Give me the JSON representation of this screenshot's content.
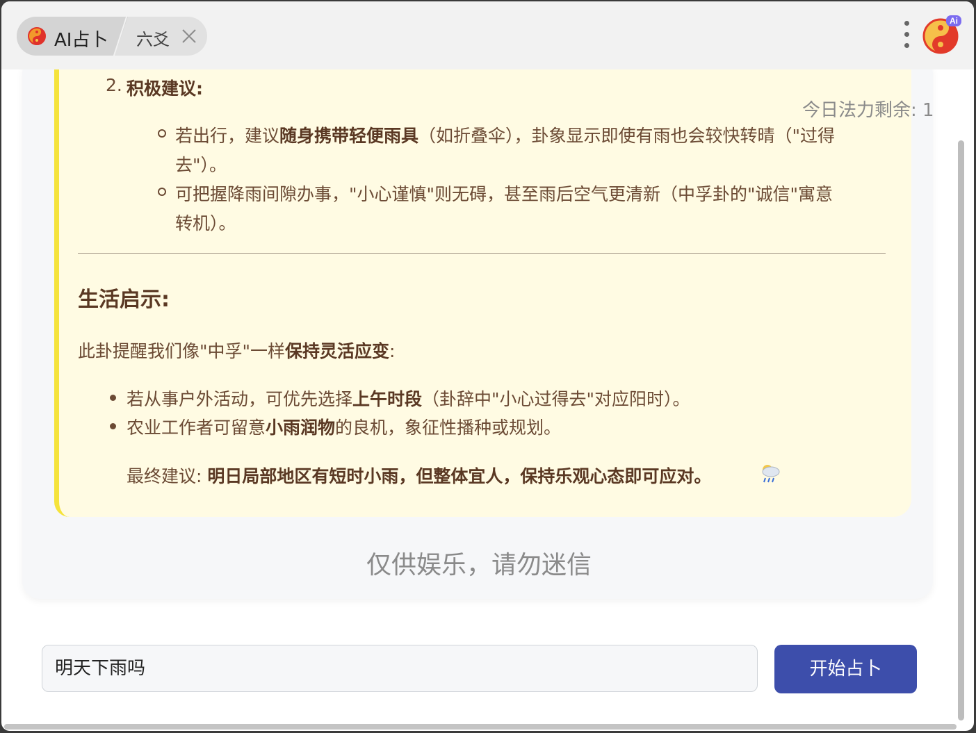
{
  "tabs": {
    "active_label": "AI占卜",
    "second_label": "六爻"
  },
  "quota": "今日法力剩余: 1",
  "badge": "Ai",
  "reading": {
    "section2_number": "2.",
    "section2_title": "积极建议:",
    "bullet1_line1_pre": "若出行，建议",
    "bullet1_line1_bold": "随身携带轻便雨具",
    "bullet1_line1_post": "（如折叠伞），卦象显示即使有雨也会较快转晴（\"过得",
    "bullet1_line2": "去\"）。",
    "bullet2_line1": "可把握降雨间隙办事，\"小心谨慎\"则无碍，甚至雨后空气更清新（中孚卦的\"诚信\"寓意",
    "bullet2_line2": "转机）。",
    "life_title": "生活启示:",
    "life_intro_pre": "此卦提醒我们像\"中孚\"一样",
    "life_intro_bold": "保持灵活应变",
    "life_intro_post": ":",
    "life_item1_pre": "若从事户外活动，可优先选择",
    "life_item1_bold": "上午时段",
    "life_item1_post": "（卦辞中\"小心过得去\"对应阳时）。",
    "life_item2_pre": "农业工作者可留意",
    "life_item2_bold": "小雨润物",
    "life_item2_post": "的良机，象征性播种或规划。",
    "final_label": "最终建议:",
    "final_bold": "明日局部地区有短时小雨，但整体宜人，保持乐观心态即可应对。",
    "final_emoji": "🌧"
  },
  "disclaimer": "仅供娱乐，请勿迷信",
  "input": {
    "value": "明天下雨吗"
  },
  "start_button": "开始占卜",
  "icons": [
    "yin-yang-icon",
    "close-icon",
    "more-vertical-icon",
    "ai-logo-icon",
    "rain-cloud-icon"
  ]
}
